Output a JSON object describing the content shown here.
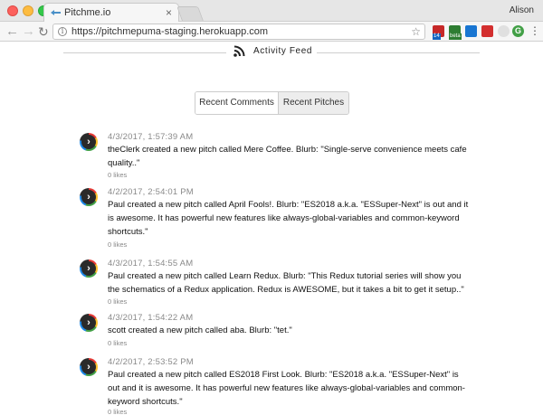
{
  "browser": {
    "tab_title": "Pitchme.io",
    "tab_close": "×",
    "profile_name": "Alison",
    "url": "https://pitchmepuma-staging.herokuapp.com",
    "ext_badge_1": "14",
    "ext_badge_2": "beta",
    "ext_grammarly": "G",
    "menu": "⋮"
  },
  "feed": {
    "title": "Activity Feed",
    "tabs": [
      {
        "label": "Recent Comments",
        "active": false
      },
      {
        "label": "Recent Pitches",
        "active": true
      }
    ],
    "items": [
      {
        "timestamp": "4/3/2017, 1:57:39 AM",
        "text": "theClerk created a new pitch called Mere Coffee. Blurb: \"Single-serve convenience meets cafe quality..\"",
        "likes": "0 likes"
      },
      {
        "timestamp": "4/2/2017, 2:54:01 PM",
        "text": "Paul created a new pitch called April Fools!. Blurb: \"ES2018 a.k.a. \"ESSuper-Next\" is out and it is awesome. It has powerful new features like always-global-variables and common-keyword shortcuts.\"",
        "likes": "0 likes"
      },
      {
        "timestamp": "4/3/2017, 1:54:55 AM",
        "text": "Paul created a new pitch called Learn Redux. Blurb: \"This Redux tutorial series will show you the schematics of a Redux application. Redux is AWESOME, but it takes a bit to get it setup..\"",
        "likes": "0 likes"
      },
      {
        "timestamp": "4/3/2017, 1:54:22 AM",
        "text": "scott created a new pitch called aba. Blurb: \"tet.\"",
        "likes": "0 likes"
      },
      {
        "timestamp": "4/2/2017, 2:53:52 PM",
        "text": "Paul created a new pitch called ES2018 First Look. Blurb: \"ES2018 a.k.a. \"ESSuper-Next\" is out and it is awesome. It has powerful new features like always-global-variables and common-keyword shortcuts.\"",
        "likes": "0 likes"
      }
    ]
  },
  "colors": {
    "tab_active_bg": "#ededed",
    "avatar_dark": "#2a2a2a"
  }
}
